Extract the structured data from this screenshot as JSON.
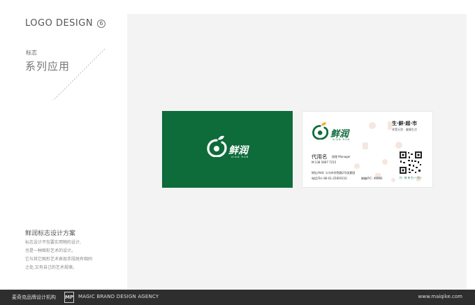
{
  "header": {
    "title": "LOGO DESIGN",
    "page_number": "6"
  },
  "section": {
    "label_small": "标志",
    "label_big": "系列应用"
  },
  "description": {
    "title": "鲜润标志设计方案",
    "lines": [
      "标志设计不仅要实用物的设计,",
      "也是一种图形艺术的设计。",
      "它与其它图形艺术表现手段既有相同",
      "之处,又有自己的艺术规律。"
    ]
  },
  "brand": {
    "name_cn": "鲜润",
    "name_pinyin": "XIAN RUN",
    "green": "#0e6b3a",
    "orange": "#f2a81d"
  },
  "card_back": {
    "slogan": "生·鲜·超·市",
    "slogan_sub": "享受天然 · 健康生活",
    "person": "代用名",
    "role": "经理 Manager",
    "mobile": "M:138 5897 7215",
    "address": "地址/Add: 义乌市学院路2号创意园",
    "phone": "电话/Tel: 86-01-25859110",
    "postcode": "邮编/P.C: 40060",
    "qr_caption": "扫 · 快 来 扫 一 扫 !"
  },
  "footer": {
    "agency_cn": "麦奇克品牌设计机构",
    "mark": "MP",
    "agency_en": "MAGIC BRAND DESIGN AGENCY",
    "url": "www.maiqike.com"
  }
}
